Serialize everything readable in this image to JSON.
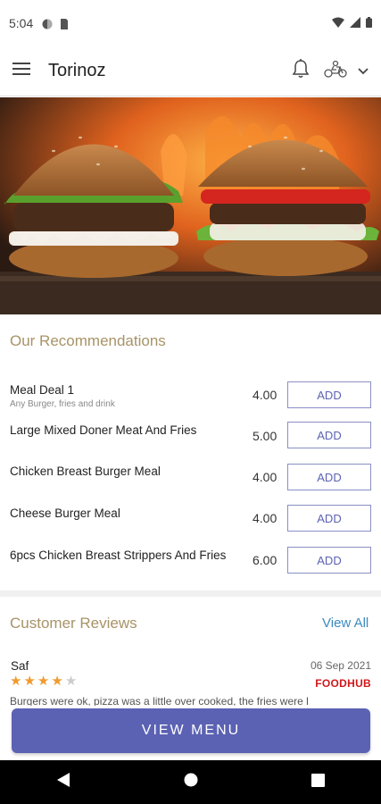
{
  "status": {
    "time": "5:04"
  },
  "app_bar": {
    "title": "Torinoz"
  },
  "recommendations": {
    "title": "Our Recommendations",
    "add_label": "ADD",
    "items": [
      {
        "name": "Meal Deal 1",
        "desc": "Any Burger, fries and drink",
        "price": "4.00"
      },
      {
        "name": "Large Mixed Doner Meat And Fries",
        "desc": "",
        "price": "5.00"
      },
      {
        "name": "Chicken Breast Burger Meal",
        "desc": "",
        "price": "4.00"
      },
      {
        "name": "Cheese Burger Meal",
        "desc": "",
        "price": "4.00"
      },
      {
        "name": "6pcs Chicken Breast Strippers And Fries",
        "desc": "",
        "price": "6.00"
      }
    ]
  },
  "reviews": {
    "title": "Customer Reviews",
    "view_all": "View All",
    "item": {
      "name": "Saf",
      "date": "06 Sep 2021",
      "rating": 4,
      "max_rating": 5,
      "source": "FOODHUB",
      "text": "Burgers were ok, pizza was a little over cooked, the fries were l"
    }
  },
  "cta": {
    "label": "VIEW MENU"
  },
  "colors": {
    "accent": "#5b62b3",
    "section_title": "#a79367",
    "star": "#f29a2e",
    "foodhub": "#d0181b",
    "link": "#3a8bbf"
  }
}
